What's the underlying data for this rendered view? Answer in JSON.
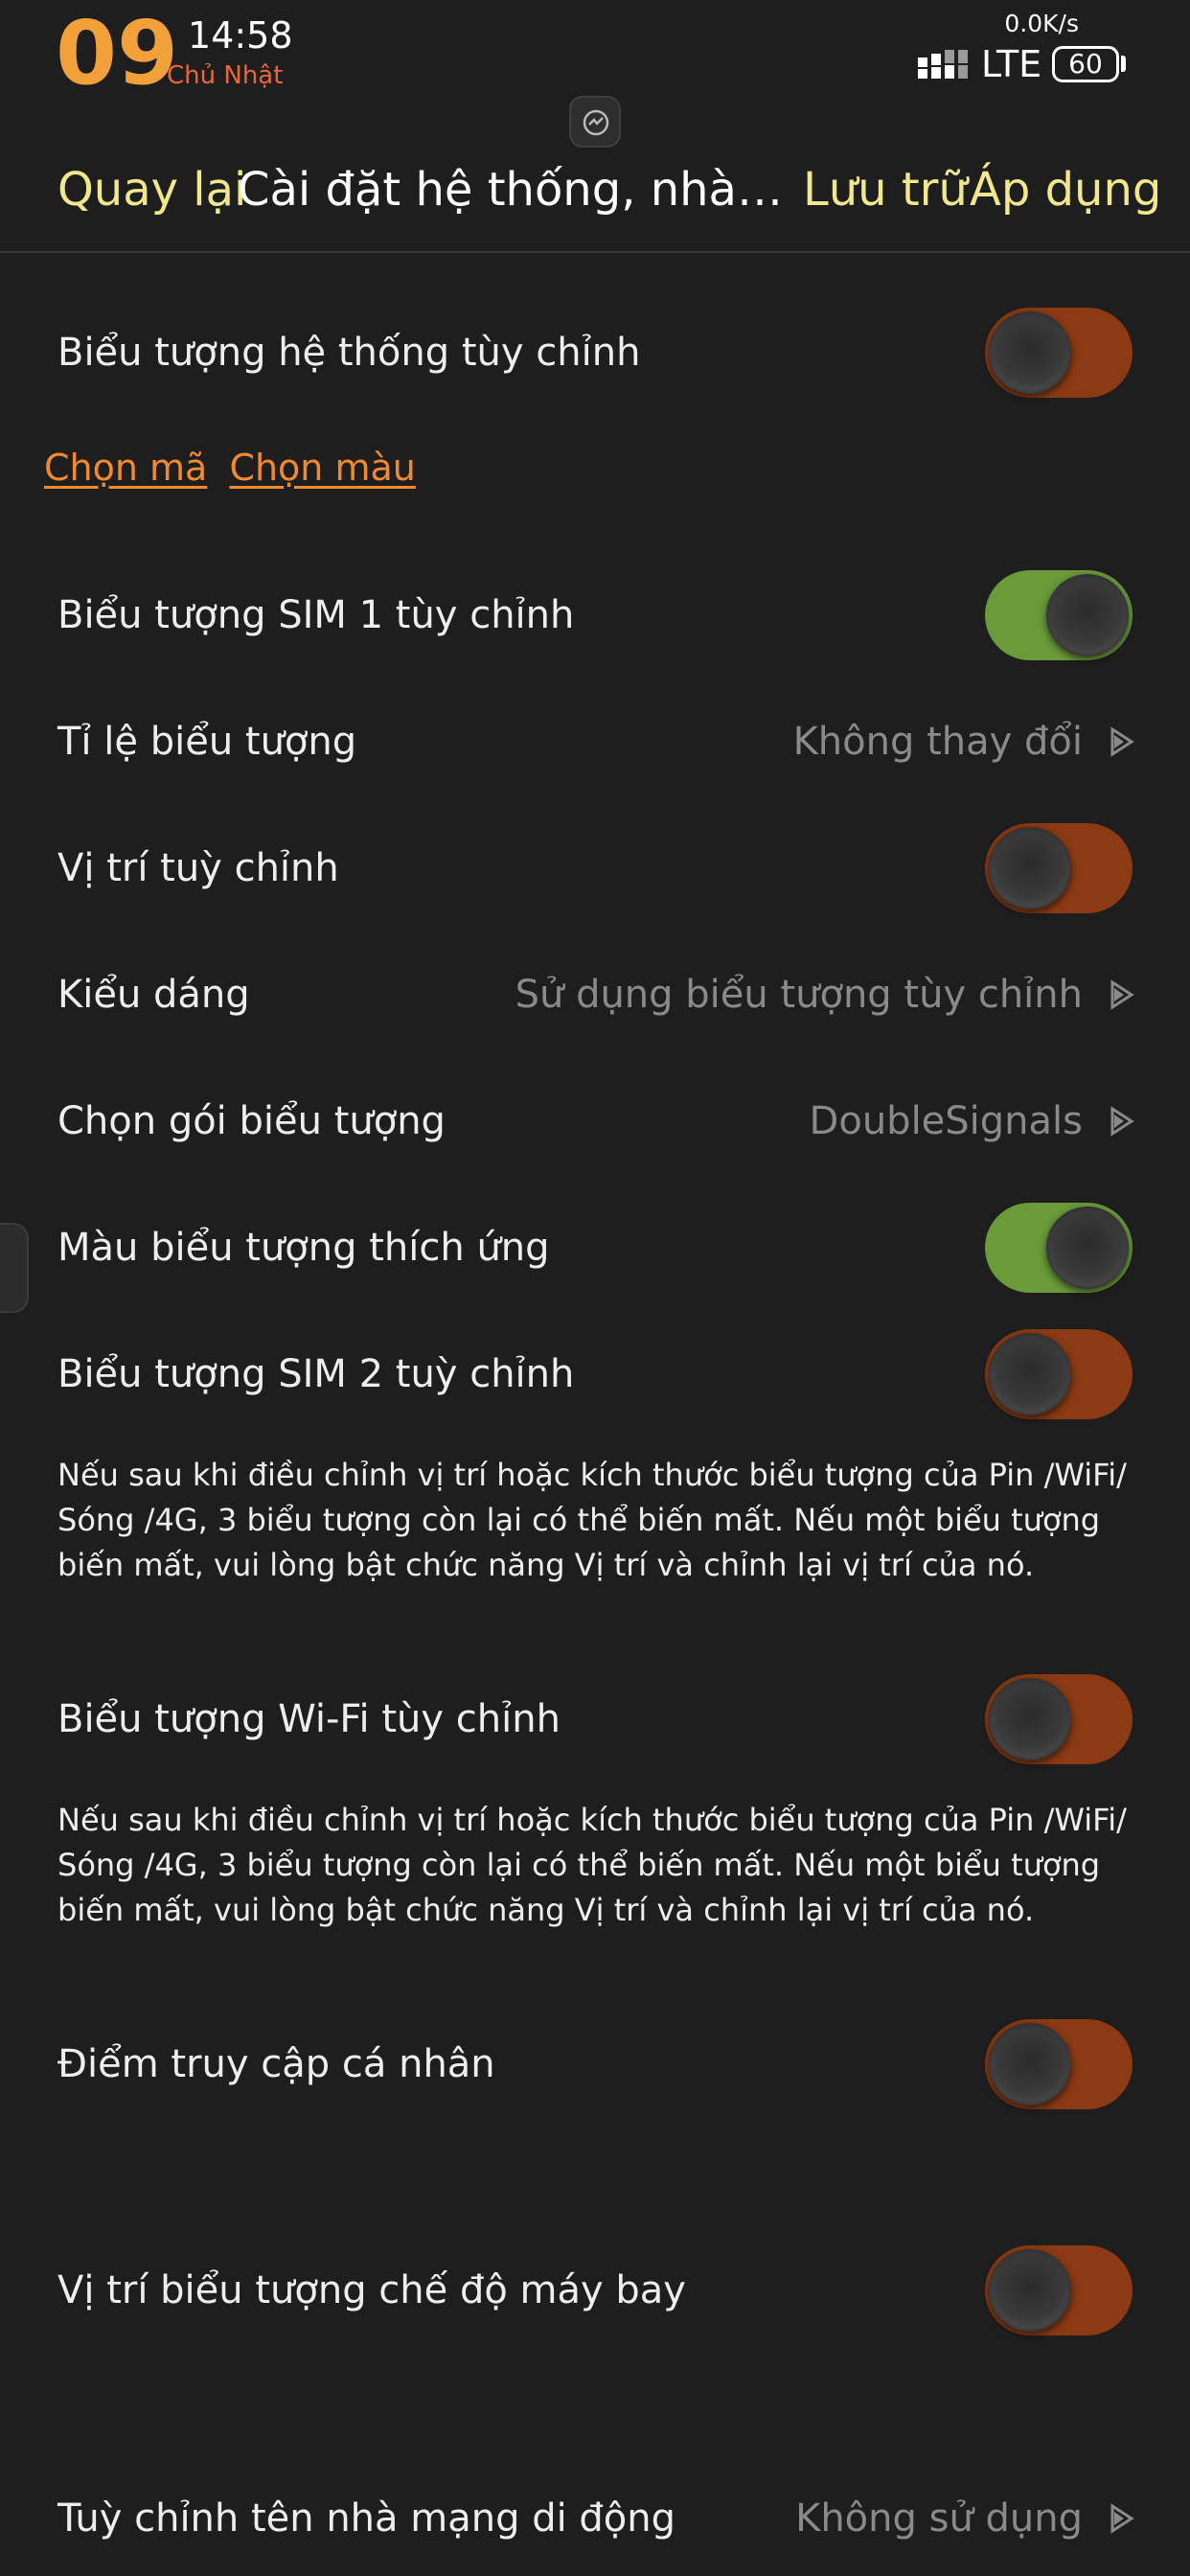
{
  "status_bar": {
    "day": "09",
    "time": "14:58",
    "weekday": "Chủ Nhật",
    "net_speed": "0.0K/s",
    "network": "LTE",
    "battery": "60",
    "signal_icon": "signal-bars-icon"
  },
  "header": {
    "back": "Quay lại",
    "title": "Cài đặt hệ thống, nhà cung...",
    "save": "Lưu trữ",
    "apply": "Áp dụng"
  },
  "colors": {
    "accent_yellow": "#f1e78c",
    "accent_orange": "#f18a2e",
    "toggle_off": "#8b3a13",
    "toggle_on": "#6a9a3a",
    "background": "#1e1e1e"
  },
  "settings": {
    "custom_system_icons": {
      "label": "Biểu tượng hệ thống tùy chỉnh",
      "state": "off"
    },
    "links": {
      "choose_code": "Chọn mã",
      "choose_color": "Chọn màu"
    },
    "custom_sim1_icon": {
      "label": "Biểu tượng SIM 1 tùy chỉnh",
      "state": "on"
    },
    "icon_ratio": {
      "label": "Tỉ lệ biểu tượng",
      "value": "Không thay đổi"
    },
    "custom_position": {
      "label": "Vị trí tuỳ chỉnh",
      "state": "off"
    },
    "style": {
      "label": "Kiểu dáng",
      "value": "Sử dụng biểu tượng tùy chỉnh"
    },
    "icon_pack": {
      "label": "Chọn gói biểu tượng",
      "value": "DoubleSignals"
    },
    "adaptive_color": {
      "label": "Màu biểu tượng thích ứng",
      "state": "on"
    },
    "custom_sim2_icon": {
      "label": "Biểu tượng SIM 2 tuỳ chỉnh",
      "state": "off"
    },
    "note_1": "Nếu sau khi điều chỉnh vị trí hoặc kích thước biểu tượng của Pin /WiFi/ Sóng /4G, 3 biểu tượng còn lại có thể biến mất. Nếu một biểu tượng biến mất, vui lòng bật chức năng Vị trí và chỉnh lại vị trí của nó.",
    "custom_wifi_icon": {
      "label": "Biểu tượng Wi-Fi tùy chỉnh",
      "state": "off"
    },
    "note_2": "Nếu sau khi điều chỉnh vị trí hoặc kích thước biểu tượng của Pin /WiFi/ Sóng /4G, 3 biểu tượng còn lại có thể biến mất. Nếu một biểu tượng biến mất, vui lòng bật chức năng Vị trí và chỉnh lại vị trí của nó.",
    "hotspot": {
      "label": "Điểm truy cập cá nhân",
      "state": "off"
    },
    "airplane_icon_position": {
      "label": "Vị trí biểu tượng chế độ máy bay",
      "state": "off"
    },
    "carrier_name": {
      "label": "Tuỳ chỉnh tên nhà mạng di động",
      "value": "Không sử dụng"
    }
  }
}
